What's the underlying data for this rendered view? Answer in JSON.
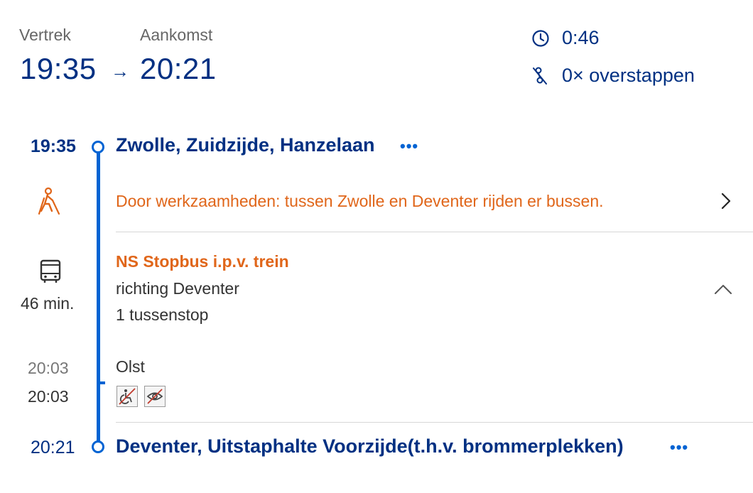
{
  "summary": {
    "departure_label": "Vertrek",
    "arrival_label": "Aankomst",
    "departure_time": "19:35",
    "arrival_time": "20:21",
    "arrow": "→",
    "duration": "0:46",
    "transfers": "0× overstappen"
  },
  "journey": {
    "origin": {
      "time": "19:35",
      "name": "Zwolle, Zuidzijde, Hanzelaan",
      "more": "•••"
    },
    "disruption": {
      "message": "Door werkzaamheden: tussen Zwolle en Deventer rijden er bussen."
    },
    "leg": {
      "operator": "NS Stopbus i.p.v. trein",
      "direction": "richting Deventer",
      "stops_count": "1 tussenstop",
      "duration": "46 min."
    },
    "intermediate_stop": {
      "name": "Olst",
      "planned_time": "20:03",
      "actual_time": "20:03"
    },
    "destination": {
      "time": "20:21",
      "name": "Deventer, Uitstaphalte Voorzijde(t.h.v. brommerplekken)",
      "more": "•••"
    }
  },
  "colors": {
    "navy": "#003082",
    "blue": "#0063d3",
    "orange": "#e0661a"
  },
  "icons": [
    "clock-icon",
    "transfer-icon",
    "walking-icon",
    "bus-icon",
    "chevron-right-icon",
    "chevron-up-icon",
    "no-wheelchair-icon",
    "no-visual-aid-icon"
  ]
}
